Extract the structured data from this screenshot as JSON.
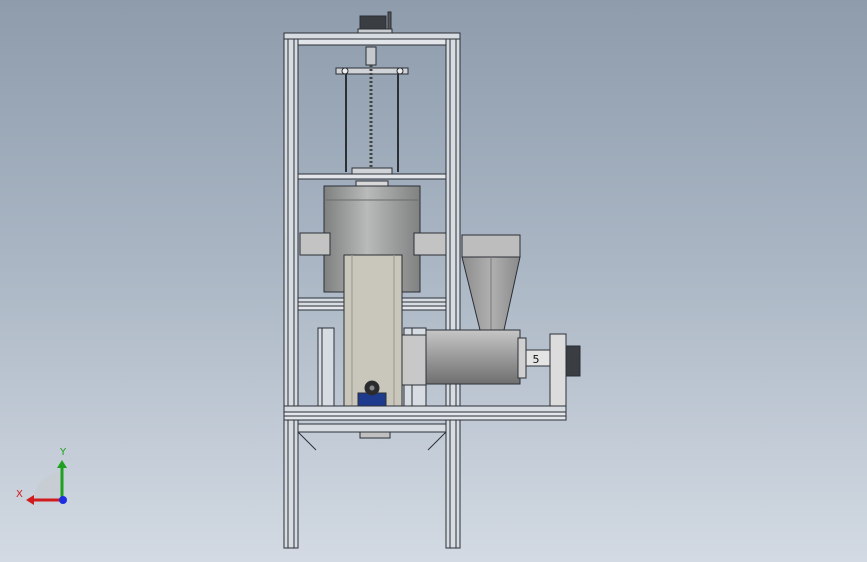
{
  "triad": {
    "x_label": "X",
    "y_label": "Y",
    "x_color": "#d01c1c",
    "y_color": "#20a020",
    "z_color": "#1c2ee0"
  },
  "annotations": {
    "position_label": "5"
  },
  "colors": {
    "frame": "#d7dce2",
    "frame_edge": "#2b2f36",
    "tank": "#9fa0a0",
    "chute": "#c9c6bb",
    "barrel": "#a6a6a6",
    "motor_blue": "#1d3a8c"
  }
}
